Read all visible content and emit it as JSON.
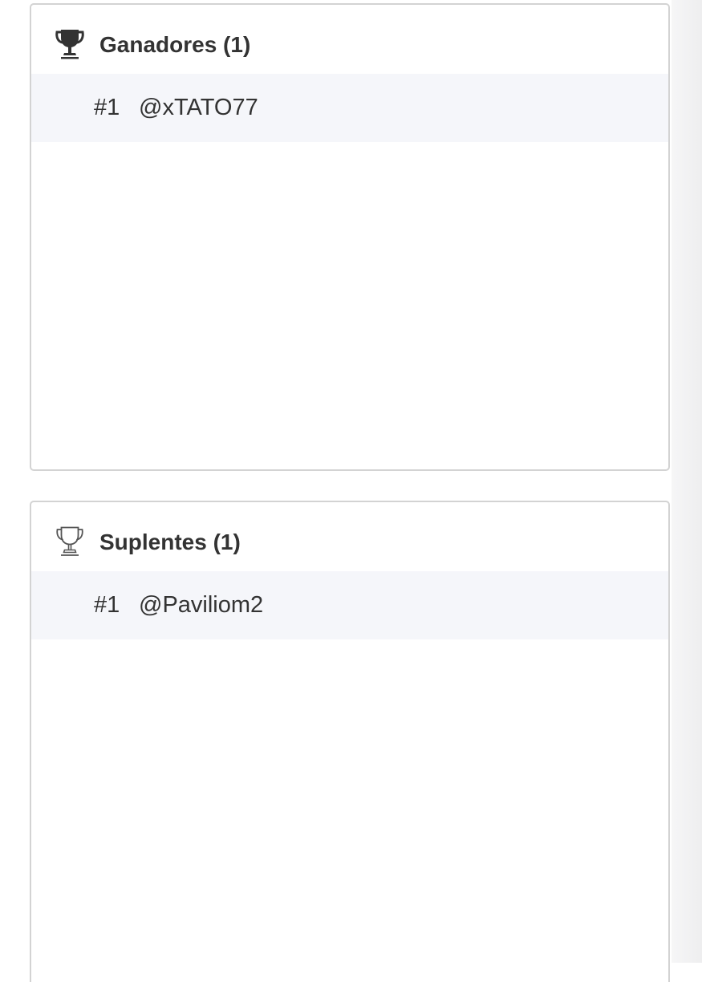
{
  "winners": {
    "title": "Ganadores (1)",
    "icon": "trophy-filled-icon",
    "entries": [
      {
        "rank": "#1",
        "username": "@xTATO77"
      }
    ]
  },
  "substitutes": {
    "title": "Suplentes (1)",
    "icon": "trophy-outline-icon",
    "entries": [
      {
        "rank": "#1",
        "username": "@Paviliom2"
      }
    ]
  },
  "colors": {
    "text": "#333333",
    "row_background": "#f5f6fa",
    "panel_border": "#d3d3d3"
  }
}
